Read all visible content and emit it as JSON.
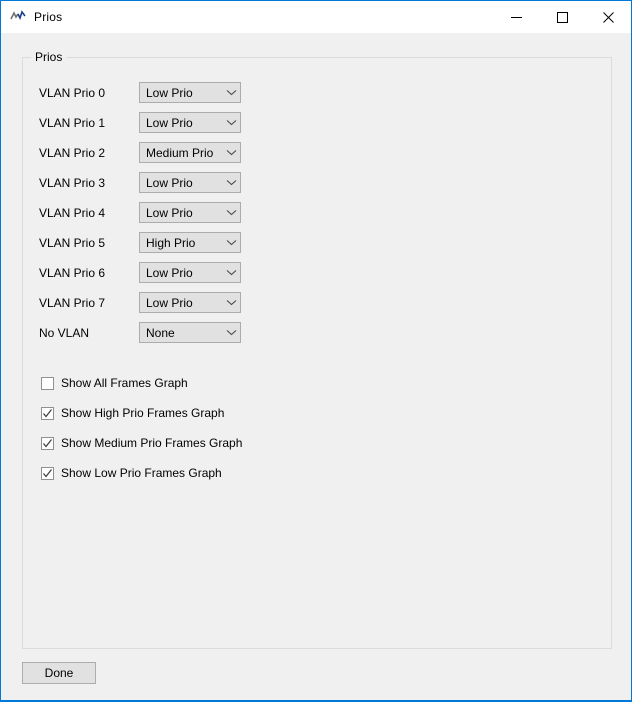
{
  "window": {
    "title": "Prios",
    "icon": "chart-line-icon",
    "border_color": "#0078d7",
    "background": "#f0f0f0",
    "controls": {
      "minimize": "Minimize",
      "maximize": "Maximize",
      "close": "Close"
    }
  },
  "groupbox": {
    "title": "Prios"
  },
  "prio_rows": [
    {
      "label": "VLAN Prio 0",
      "value": "Low Prio"
    },
    {
      "label": "VLAN Prio 1",
      "value": "Low Prio"
    },
    {
      "label": "VLAN Prio 2",
      "value": "Medium Prio"
    },
    {
      "label": "VLAN Prio 3",
      "value": "Low Prio"
    },
    {
      "label": "VLAN Prio 4",
      "value": "Low Prio"
    },
    {
      "label": "VLAN Prio 5",
      "value": "High Prio"
    },
    {
      "label": "VLAN Prio 6",
      "value": "Low Prio"
    },
    {
      "label": "VLAN Prio 7",
      "value": "Low Prio"
    },
    {
      "label": "No VLAN",
      "value": "None"
    }
  ],
  "checkboxes": [
    {
      "label": "Show All Frames Graph",
      "checked": false
    },
    {
      "label": "Show High Prio Frames Graph",
      "checked": true
    },
    {
      "label": "Show Medium Prio Frames Graph",
      "checked": true
    },
    {
      "label": "Show Low Prio Frames Graph",
      "checked": true
    }
  ],
  "buttons": {
    "done": "Done"
  }
}
